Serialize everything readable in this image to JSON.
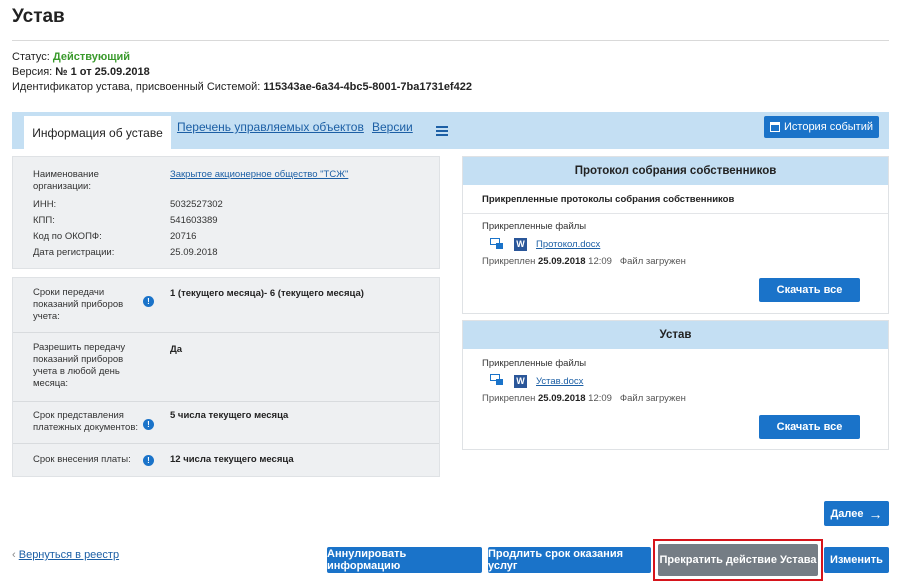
{
  "page": {
    "title": "Устав",
    "status_label": "Статус: ",
    "status_value": "Действующий",
    "version_label": "Версия: ",
    "version_value": "№ 1 от 25.09.2018",
    "id_label": "Идентификатор устава, присвоенный Системой: ",
    "id_value": "115343ae-6a34-4bc5-8001-7ba1731ef422"
  },
  "tabs": {
    "items": [
      "Информация об уставе",
      "Перечень управляемых объектов",
      "Версии"
    ],
    "history_button": "История событий"
  },
  "org": {
    "rows": [
      {
        "label": "Наименование организации:",
        "value": "Закрытое акционерное общество \"ТСЖ\""
      },
      {
        "label": "ИНН:",
        "value": "5032527302"
      },
      {
        "label": "КПП:",
        "value": "541603389"
      },
      {
        "label": "Код по ОКОПФ:",
        "value": "20716"
      },
      {
        "label": "Дата регистрации:",
        "value": "25.09.2018"
      }
    ]
  },
  "settings": {
    "rows": [
      {
        "label": "Сроки передачи показаний приборов учета:",
        "value": "1 (текущего месяца)- 6 (текущего месяца)"
      },
      {
        "label": "Разрешить передачу показаний приборов учета в любой день месяца:",
        "value": "Да"
      },
      {
        "label": "Срок представления платежных документов:",
        "value": "5 числа текущего месяца"
      },
      {
        "label": "Срок внесения платы:",
        "value": "12 числа текущего месяца"
      }
    ]
  },
  "protocol_box": {
    "title": "Протокол собрания собственников",
    "subtitle": "Прикрепленные протоколы собрания собственников",
    "files_label": "Прикрепленные файлы",
    "file_name": "Протокол.docx",
    "attached_prefix": "Прикреплен ",
    "attached_date": "25.09.2018",
    "attached_time": " 12:09",
    "status": "Файл загружен",
    "download": "Скачать все"
  },
  "ustav_box": {
    "title": "Устав",
    "files_label": "Прикрепленные файлы",
    "file_name": "Устав.docx",
    "attached_prefix": "Прикреплен ",
    "attached_date": "25.09.2018",
    "attached_time": " 12:09",
    "status": "Файл загружен",
    "download": "Скачать все"
  },
  "footer": {
    "next": "Далее",
    "back": "Вернуться в реестр",
    "annul": "Аннулировать информацию",
    "extend": "Продлить срок оказания услуг",
    "terminate": "Прекратить действие Устава",
    "edit": "Изменить"
  },
  "colors": {
    "accent": "#1a73c9",
    "tab_bar": "#c4dff3",
    "status_green": "#3a9a2c",
    "highlight_red": "#d6141b"
  }
}
